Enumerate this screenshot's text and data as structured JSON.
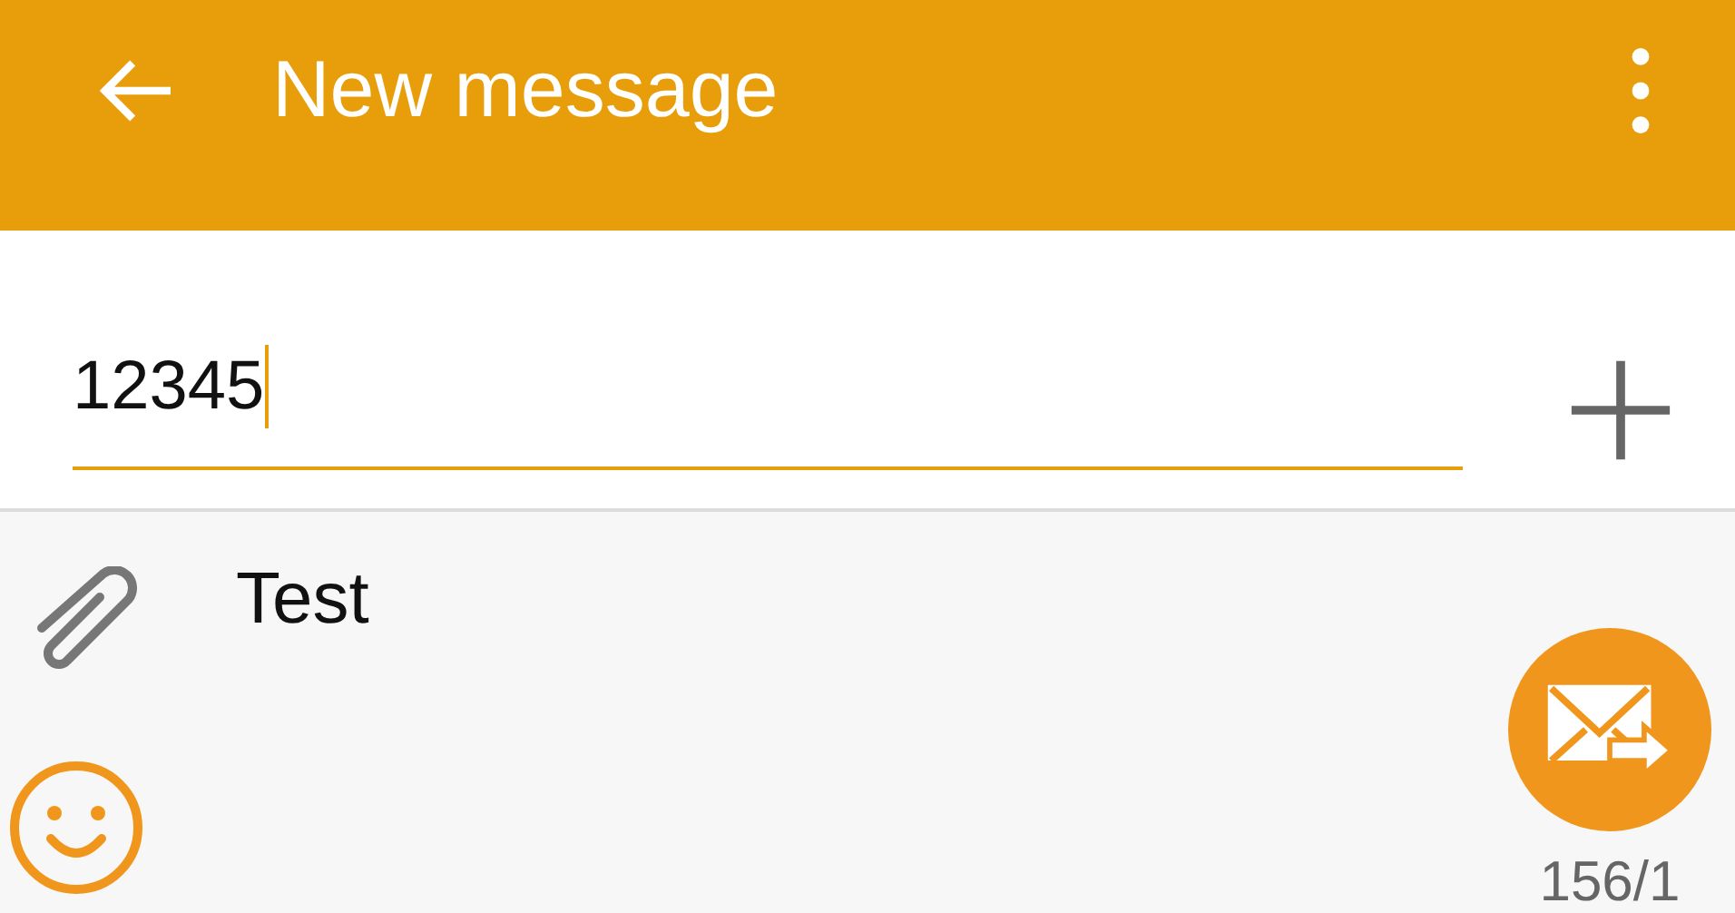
{
  "app_bar": {
    "title": "New message"
  },
  "recipient": {
    "value": "12345"
  },
  "message": {
    "value": "Test"
  },
  "send": {
    "counter": "156/1"
  }
}
